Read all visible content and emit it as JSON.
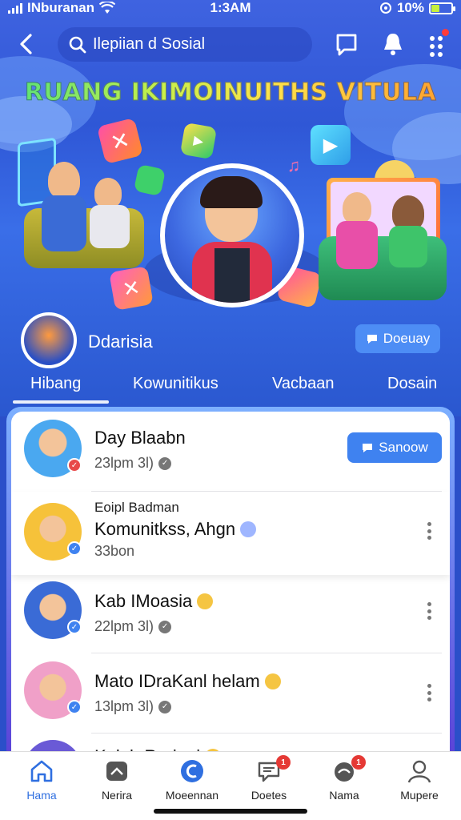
{
  "status_bar": {
    "carrier": "INburanan",
    "time": "1:3AM",
    "battery": "10%"
  },
  "search": {
    "value": "Ilepiian d Sosial"
  },
  "banner": {
    "title": "RUANG IKIMOINUITHS VITULA"
  },
  "profile": {
    "name": "Ddarisia",
    "follow_label": "Doeuay"
  },
  "tabs": [
    {
      "label": "Hibang"
    },
    {
      "label": "Kowunitikus"
    },
    {
      "label": "Vacbaan"
    },
    {
      "label": "Dosain"
    }
  ],
  "feed": [
    {
      "title": "Day Blaabn",
      "time": "23lpm 3l)",
      "button": "Sanoow"
    },
    {
      "top": "Eoipl Badman",
      "title": "Komunitkss, Ahgn",
      "time": "33bon"
    },
    {
      "title": "Kab IMoasia",
      "time": "22lpm 3l)"
    },
    {
      "title": "Mato IDraKanl helam",
      "time": "13lpm 3l)"
    },
    {
      "title": "Kolab Rpriogi"
    }
  ],
  "bottom_nav": [
    {
      "label": "Hama",
      "icon": "home-icon",
      "active": true
    },
    {
      "label": "Nerira",
      "icon": "hat-icon"
    },
    {
      "label": "Moeennan",
      "icon": "chat-bubble-icon"
    },
    {
      "label": "Doetes",
      "icon": "message-icon",
      "badge": "1"
    },
    {
      "label": "Nama",
      "icon": "notification-icon",
      "badge": "1"
    },
    {
      "label": "Mupere",
      "icon": "profile-icon"
    }
  ],
  "colors": {
    "accent": "#3f82f0",
    "header_bg": "#3a62df",
    "badge_red": "#e53935"
  }
}
